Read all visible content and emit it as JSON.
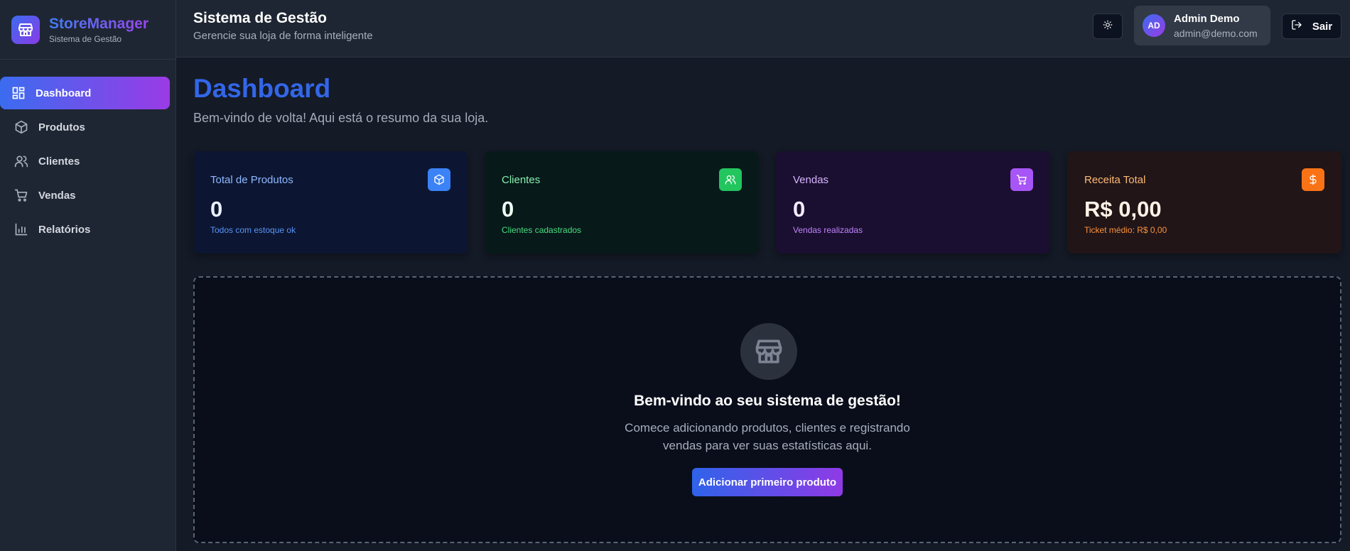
{
  "brand": {
    "name": "StoreManager",
    "subtitle": "Sistema de Gestão"
  },
  "sidebar": {
    "items": [
      {
        "label": "Dashboard",
        "icon": "layout-dashboard-icon",
        "active": true
      },
      {
        "label": "Produtos",
        "icon": "package-icon"
      },
      {
        "label": "Clientes",
        "icon": "users-icon"
      },
      {
        "label": "Vendas",
        "icon": "shopping-cart-icon"
      },
      {
        "label": "Relatórios",
        "icon": "bar-chart-icon"
      }
    ]
  },
  "header": {
    "title": "Sistema de Gestão",
    "subtitle": "Gerencie sua loja de forma inteligente",
    "user": {
      "initials": "AD",
      "name": "Admin Demo",
      "email": "admin@demo.com"
    },
    "logout_label": "Sair"
  },
  "main": {
    "title": "Dashboard",
    "subtitle": "Bem-vindo de volta! Aqui está o resumo da sua loja.",
    "cards": [
      {
        "label": "Total de Produtos",
        "value": "0",
        "foot": "Todos com estoque ok",
        "icon": "package-icon",
        "accent": "#3b82f6"
      },
      {
        "label": "Clientes",
        "value": "0",
        "foot": "Clientes cadastrados",
        "icon": "users-icon",
        "accent": "#22c55e"
      },
      {
        "label": "Vendas",
        "value": "0",
        "foot": "Vendas realizadas",
        "icon": "shopping-cart-icon",
        "accent": "#a855f7"
      },
      {
        "label": "Receita Total",
        "value": "R$ 0,00",
        "foot": "Ticket médio: R$ 0,00",
        "icon": "dollar-sign-icon",
        "accent": "#f97316"
      }
    ],
    "empty_state": {
      "title": "Bem-vindo ao seu sistema de gestão!",
      "text": "Comece adicionando produtos, clientes e registrando vendas para ver suas estatísticas aqui.",
      "button": "Adicionar primeiro produto",
      "icon": "store-icon"
    }
  },
  "colors": {
    "accent_blue": "#3366e8",
    "accent_purple": "#9a3be6",
    "background": "#141a26",
    "panel": "#1f2633"
  }
}
